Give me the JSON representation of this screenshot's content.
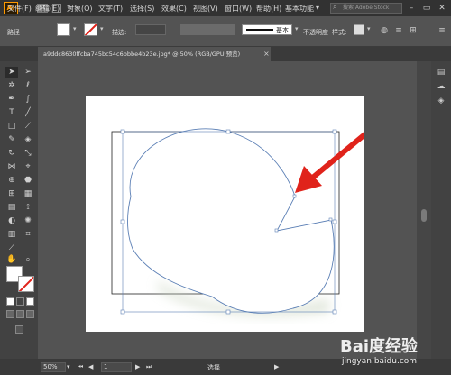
{
  "app": {
    "logo_text": "Ai"
  },
  "menu": {
    "items": [
      "文件(F)",
      "编辑(E)",
      "对象(O)",
      "文字(T)",
      "选择(S)",
      "效果(C)",
      "视图(V)",
      "窗口(W)",
      "帮助(H)"
    ],
    "st_label": "St",
    "workspace": "基本功能",
    "search_placeholder": "搜索 Adobe Stock"
  },
  "control_bar": {
    "path_label": "路径",
    "stroke_label": "描边:",
    "stroke_style_label": "基本",
    "opacity_label": "不透明度",
    "style_label": "样式:"
  },
  "document": {
    "tab_title": "a9ddc8630ffcba745bc54c6bbbe4b23e.jpg* @ 50% (RGB/GPU 预览)",
    "close_glyph": "×"
  },
  "status_bar": {
    "zoom": "50%",
    "artboard_number": "1",
    "tool_label": "选择"
  },
  "watermark": {
    "main": "Bai度经验",
    "sub": "jingyan.baidu.com"
  },
  "colors": {
    "arrow": "#e0231b",
    "path_stroke": "#5b7fb5",
    "menubar_bg": "#323232",
    "panel_bg": "#535353",
    "artboard_bg": "#ffffff",
    "stroke_none_slash": "#e0231b"
  },
  "icons": {
    "toolbar": [
      "selection-tool-icon",
      "direct-selection-tool-icon",
      "magic-wand-tool-icon",
      "lasso-tool-icon",
      "pen-tool-icon",
      "curvature-tool-icon",
      "type-tool-icon",
      "line-segment-tool-icon",
      "rectangle-tool-icon",
      "paintbrush-tool-icon",
      "shaper-tool-icon",
      "eraser-tool-icon",
      "rotate-tool-icon",
      "scale-tool-icon",
      "width-tool-icon",
      "free-transform-tool-icon",
      "shape-builder-tool-icon",
      "live-paint-tool-icon",
      "perspective-grid-tool-icon",
      "mesh-tool-icon",
      "gradient-tool-icon",
      "eyedropper-tool-icon",
      "blend-tool-icon",
      "symbol-sprayer-tool-icon",
      "column-graph-tool-icon",
      "artboard-tool-icon",
      "slice-tool-icon",
      "hand-tool-icon",
      "zoom-tool-icon"
    ],
    "right_dock": [
      "properties-icon",
      "libraries-icon",
      "layers-icon"
    ]
  }
}
